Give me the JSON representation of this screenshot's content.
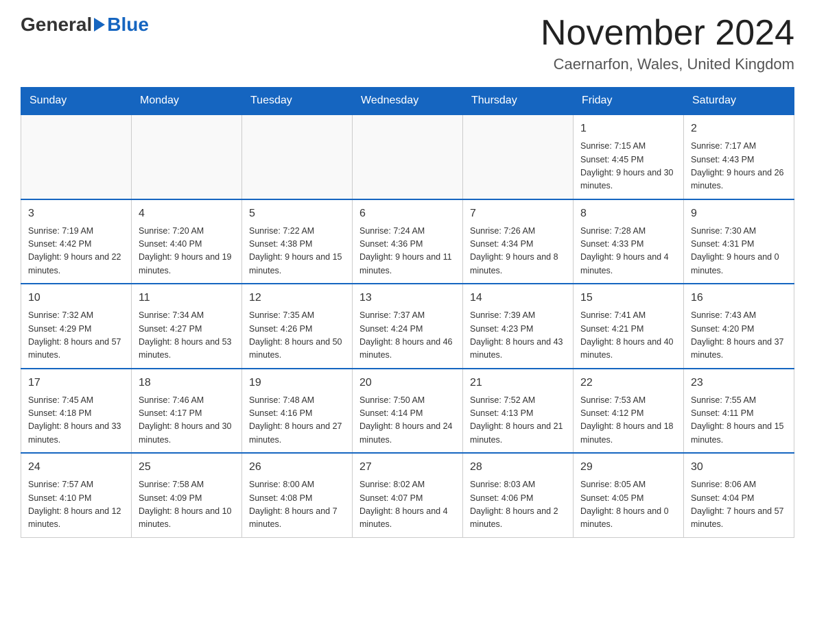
{
  "logo": {
    "general": "General",
    "blue": "Blue"
  },
  "title": "November 2024",
  "subtitle": "Caernarfon, Wales, United Kingdom",
  "days_of_week": [
    "Sunday",
    "Monday",
    "Tuesday",
    "Wednesday",
    "Thursday",
    "Friday",
    "Saturday"
  ],
  "weeks": [
    [
      {
        "day": "",
        "info": ""
      },
      {
        "day": "",
        "info": ""
      },
      {
        "day": "",
        "info": ""
      },
      {
        "day": "",
        "info": ""
      },
      {
        "day": "",
        "info": ""
      },
      {
        "day": "1",
        "info": "Sunrise: 7:15 AM\nSunset: 4:45 PM\nDaylight: 9 hours\nand 30 minutes."
      },
      {
        "day": "2",
        "info": "Sunrise: 7:17 AM\nSunset: 4:43 PM\nDaylight: 9 hours\nand 26 minutes."
      }
    ],
    [
      {
        "day": "3",
        "info": "Sunrise: 7:19 AM\nSunset: 4:42 PM\nDaylight: 9 hours\nand 22 minutes."
      },
      {
        "day": "4",
        "info": "Sunrise: 7:20 AM\nSunset: 4:40 PM\nDaylight: 9 hours\nand 19 minutes."
      },
      {
        "day": "5",
        "info": "Sunrise: 7:22 AM\nSunset: 4:38 PM\nDaylight: 9 hours\nand 15 minutes."
      },
      {
        "day": "6",
        "info": "Sunrise: 7:24 AM\nSunset: 4:36 PM\nDaylight: 9 hours\nand 11 minutes."
      },
      {
        "day": "7",
        "info": "Sunrise: 7:26 AM\nSunset: 4:34 PM\nDaylight: 9 hours\nand 8 minutes."
      },
      {
        "day": "8",
        "info": "Sunrise: 7:28 AM\nSunset: 4:33 PM\nDaylight: 9 hours\nand 4 minutes."
      },
      {
        "day": "9",
        "info": "Sunrise: 7:30 AM\nSunset: 4:31 PM\nDaylight: 9 hours\nand 0 minutes."
      }
    ],
    [
      {
        "day": "10",
        "info": "Sunrise: 7:32 AM\nSunset: 4:29 PM\nDaylight: 8 hours\nand 57 minutes."
      },
      {
        "day": "11",
        "info": "Sunrise: 7:34 AM\nSunset: 4:27 PM\nDaylight: 8 hours\nand 53 minutes."
      },
      {
        "day": "12",
        "info": "Sunrise: 7:35 AM\nSunset: 4:26 PM\nDaylight: 8 hours\nand 50 minutes."
      },
      {
        "day": "13",
        "info": "Sunrise: 7:37 AM\nSunset: 4:24 PM\nDaylight: 8 hours\nand 46 minutes."
      },
      {
        "day": "14",
        "info": "Sunrise: 7:39 AM\nSunset: 4:23 PM\nDaylight: 8 hours\nand 43 minutes."
      },
      {
        "day": "15",
        "info": "Sunrise: 7:41 AM\nSunset: 4:21 PM\nDaylight: 8 hours\nand 40 minutes."
      },
      {
        "day": "16",
        "info": "Sunrise: 7:43 AM\nSunset: 4:20 PM\nDaylight: 8 hours\nand 37 minutes."
      }
    ],
    [
      {
        "day": "17",
        "info": "Sunrise: 7:45 AM\nSunset: 4:18 PM\nDaylight: 8 hours\nand 33 minutes."
      },
      {
        "day": "18",
        "info": "Sunrise: 7:46 AM\nSunset: 4:17 PM\nDaylight: 8 hours\nand 30 minutes."
      },
      {
        "day": "19",
        "info": "Sunrise: 7:48 AM\nSunset: 4:16 PM\nDaylight: 8 hours\nand 27 minutes."
      },
      {
        "day": "20",
        "info": "Sunrise: 7:50 AM\nSunset: 4:14 PM\nDaylight: 8 hours\nand 24 minutes."
      },
      {
        "day": "21",
        "info": "Sunrise: 7:52 AM\nSunset: 4:13 PM\nDaylight: 8 hours\nand 21 minutes."
      },
      {
        "day": "22",
        "info": "Sunrise: 7:53 AM\nSunset: 4:12 PM\nDaylight: 8 hours\nand 18 minutes."
      },
      {
        "day": "23",
        "info": "Sunrise: 7:55 AM\nSunset: 4:11 PM\nDaylight: 8 hours\nand 15 minutes."
      }
    ],
    [
      {
        "day": "24",
        "info": "Sunrise: 7:57 AM\nSunset: 4:10 PM\nDaylight: 8 hours\nand 12 minutes."
      },
      {
        "day": "25",
        "info": "Sunrise: 7:58 AM\nSunset: 4:09 PM\nDaylight: 8 hours\nand 10 minutes."
      },
      {
        "day": "26",
        "info": "Sunrise: 8:00 AM\nSunset: 4:08 PM\nDaylight: 8 hours\nand 7 minutes."
      },
      {
        "day": "27",
        "info": "Sunrise: 8:02 AM\nSunset: 4:07 PM\nDaylight: 8 hours\nand 4 minutes."
      },
      {
        "day": "28",
        "info": "Sunrise: 8:03 AM\nSunset: 4:06 PM\nDaylight: 8 hours\nand 2 minutes."
      },
      {
        "day": "29",
        "info": "Sunrise: 8:05 AM\nSunset: 4:05 PM\nDaylight: 8 hours\nand 0 minutes."
      },
      {
        "day": "30",
        "info": "Sunrise: 8:06 AM\nSunset: 4:04 PM\nDaylight: 7 hours\nand 57 minutes."
      }
    ]
  ]
}
